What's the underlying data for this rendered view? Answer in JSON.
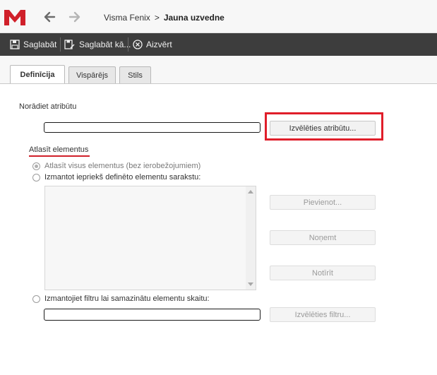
{
  "header": {
    "breadcrumb_root": "Visma Fenix",
    "breadcrumb_sep": ">",
    "breadcrumb_current": "Jauna uzvedne"
  },
  "toolbar": {
    "save": "Saglabāt",
    "save_as": "Saglabāt kā...",
    "close": "Aizvērt"
  },
  "tabs": [
    {
      "label": "Definīcija",
      "active": true
    },
    {
      "label": "Vispārējs",
      "active": false
    },
    {
      "label": "Stils",
      "active": false
    }
  ],
  "form": {
    "attribute_label": "Norādiet atribūtu",
    "attribute_value": "",
    "select_attribute_button": "Izvēlēties atribūtu...",
    "section_title": "Atlasīt elementus",
    "radio_all": "Atlasīt visus elementus (bez ierobežojumiem)",
    "radio_predefined": "Izmantot iepriekš definēto elementu sarakstu:",
    "add_button": "Pievienot...",
    "remove_button": "Noņemt",
    "clear_button": "Notīrīt",
    "radio_filter": "Izmantojiet filtru lai samazinātu elementu skaitu:",
    "filter_value": "",
    "select_filter_button": "Izvēlēties filtru..."
  },
  "colors": {
    "brand_red": "#d0202a",
    "toolbar_bg": "#3d3d3d",
    "highlight": "#e01e2a"
  }
}
